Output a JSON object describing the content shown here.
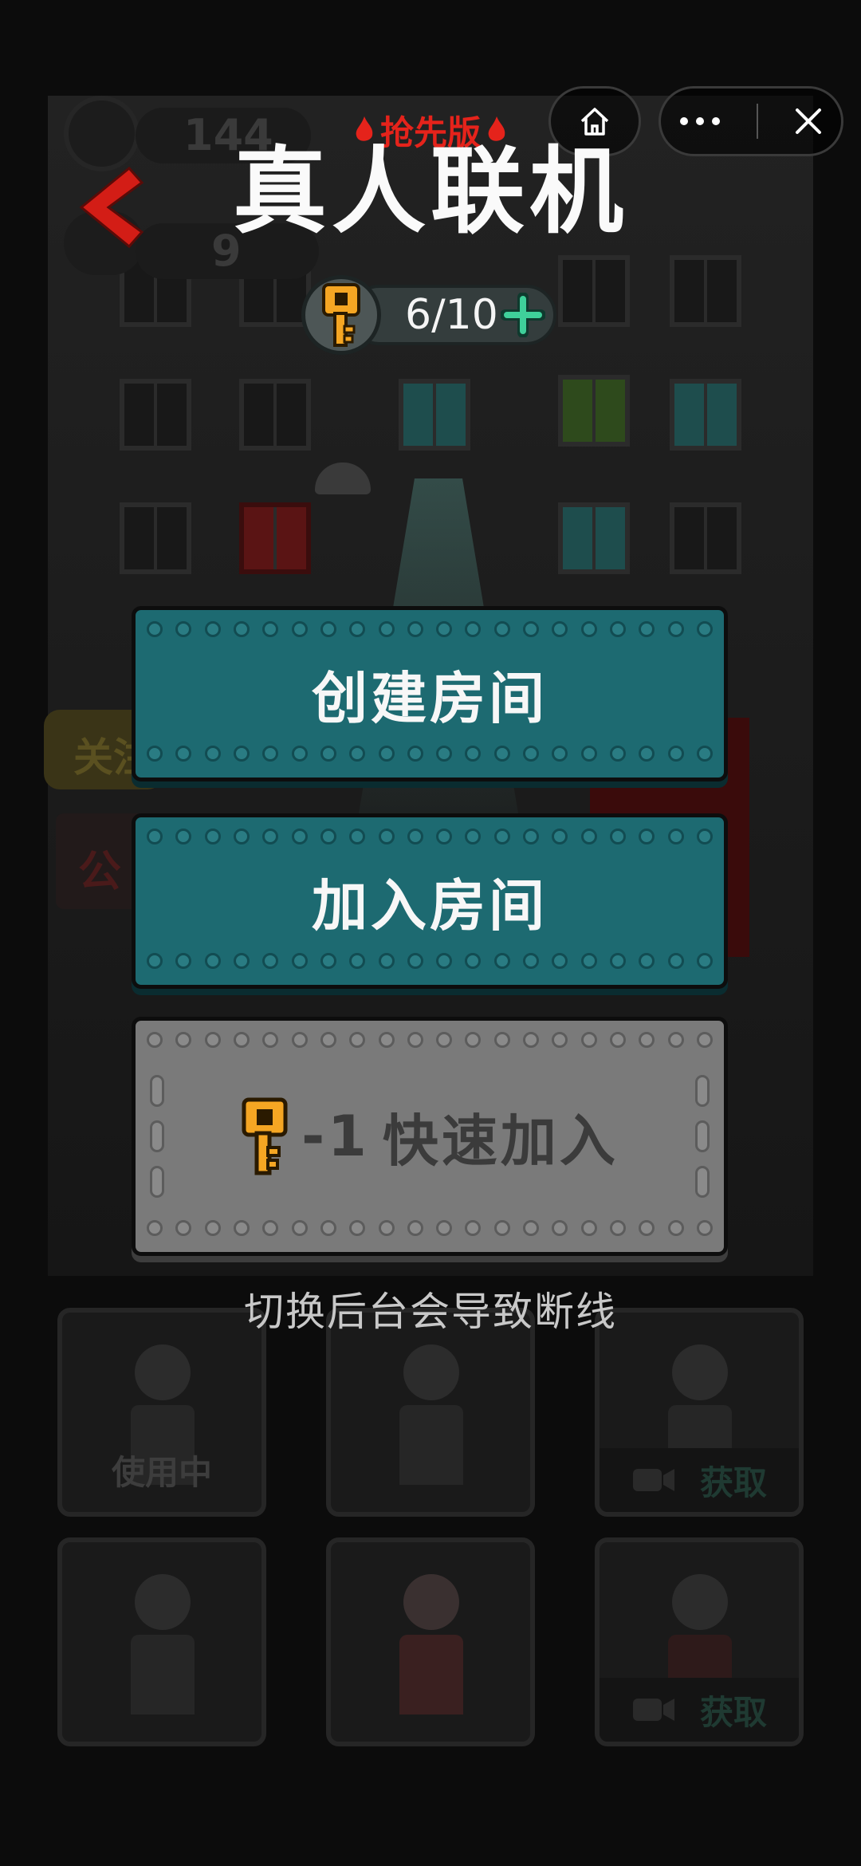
{
  "header": {
    "title": "真人联机",
    "badge": "抢先版"
  },
  "key_counter": {
    "value": "6/10"
  },
  "buttons": {
    "create_room": "创建房间",
    "join_room": "加入房间",
    "quick_join_cost": "-1",
    "quick_join": "快速加入"
  },
  "hint": "切换后台会导致断线",
  "background": {
    "coins": "144",
    "lives": "9",
    "side_left_1": "关注",
    "side_left_2": "公",
    "characters": [
      {
        "status": "使用中"
      },
      {
        "status": ""
      },
      {
        "status": "获取"
      },
      {
        "status": ""
      },
      {
        "status": ""
      },
      {
        "status": "获取"
      }
    ]
  },
  "colors": {
    "accent_red": "#e5231b",
    "teal_button": "#1d6a71",
    "gray_button": "#7a7a7a",
    "key_gold": "#f5a623",
    "plus_green": "#3fd09a"
  },
  "icons": {
    "home": "home-icon",
    "more": "more-icon",
    "close": "close-icon",
    "back": "back-chevron-icon",
    "key": "key-icon",
    "plus": "plus-icon",
    "video": "video-camera-icon",
    "flame": "flame-icon"
  }
}
